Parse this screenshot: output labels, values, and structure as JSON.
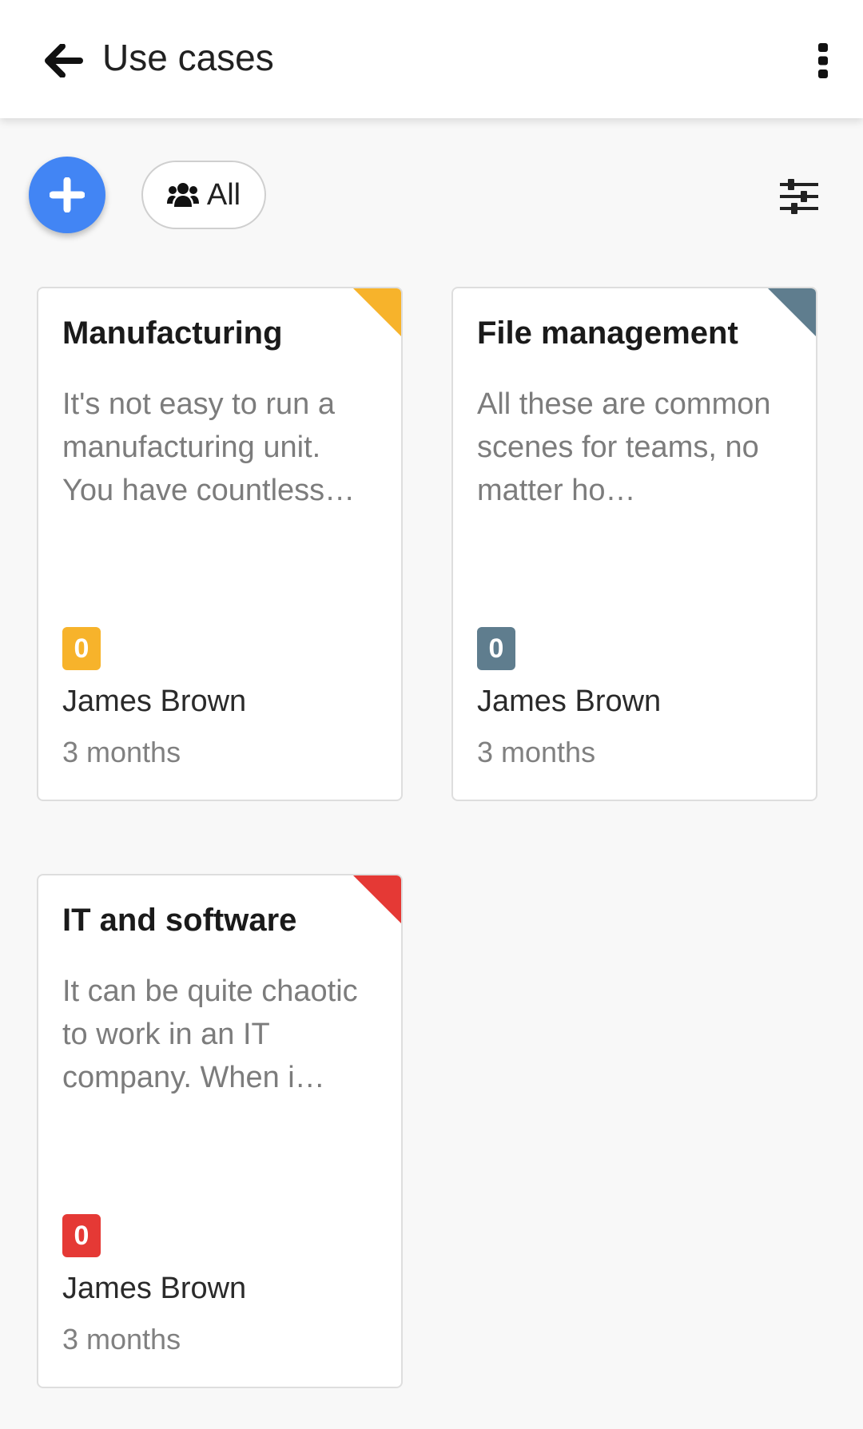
{
  "header": {
    "title": "Use cases",
    "back_icon": "arrow-left-icon",
    "more_icon": "more-vertical-icon"
  },
  "toolbar": {
    "add_icon": "plus-icon",
    "filter_chip": {
      "icon": "users-group-icon",
      "label": "All"
    },
    "settings_icon": "sliders-icon"
  },
  "colors": {
    "primary": "#4285f4",
    "manufacturing": "#f7b32b",
    "file_management": "#5f7d8e",
    "it_software": "#e53935"
  },
  "cards": [
    {
      "title": "Manufacturing",
      "description": "It's not easy to run a manufacturing unit. You have countless…",
      "count": "0",
      "author": "James Brown",
      "time": "3 months",
      "color": "#f7b32b"
    },
    {
      "title": "File management",
      "description": "All these are common scenes for teams, no matter ho…",
      "count": "0",
      "author": "James Brown",
      "time": "3 months",
      "color": "#5f7d8e"
    },
    {
      "title": "IT and software",
      "description": "It can be quite chaotic to work in an IT company. When i…",
      "count": "0",
      "author": "James Brown",
      "time": "3 months",
      "color": "#e53935"
    }
  ]
}
